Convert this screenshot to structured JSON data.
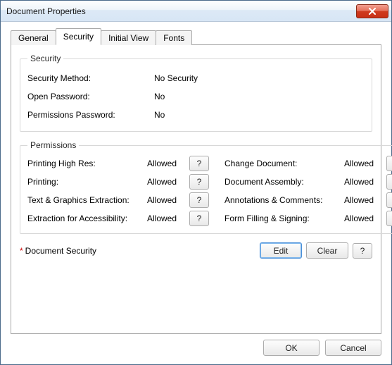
{
  "window": {
    "title": "Document Properties",
    "close_tooltip": "Close"
  },
  "tabs": {
    "general": "General",
    "security": "Security",
    "initial_view": "Initial View",
    "fonts": "Fonts",
    "active": "security"
  },
  "security_group": {
    "legend": "Security",
    "method_label": "Security Method:",
    "method_value": "No Security",
    "open_pw_label": "Open Password:",
    "open_pw_value": "No",
    "perm_pw_label": "Permissions Password:",
    "perm_pw_value": "No"
  },
  "permissions_group": {
    "legend": "Permissions",
    "help_glyph": "?",
    "rows": {
      "print_high_label": "Printing High Res:",
      "print_high_value": "Allowed",
      "printing_label": "Printing:",
      "printing_value": "Allowed",
      "extract_label": "Text & Graphics Extraction:",
      "extract_value": "Allowed",
      "access_label": "Extraction for Accessibility:",
      "access_value": "Allowed",
      "change_label": "Change Document:",
      "change_value": "Allowed",
      "assembly_label": "Document Assembly:",
      "assembly_value": "Allowed",
      "annot_label": "Annotations & Comments:",
      "annot_value": "Allowed",
      "form_label": "Form Filling & Signing:",
      "form_value": "Allowed"
    }
  },
  "doc_security": {
    "asterisk": "*",
    "label": "Document Security",
    "edit": "Edit",
    "clear": "Clear",
    "help_glyph": "?"
  },
  "footer": {
    "ok": "OK",
    "cancel": "Cancel"
  }
}
